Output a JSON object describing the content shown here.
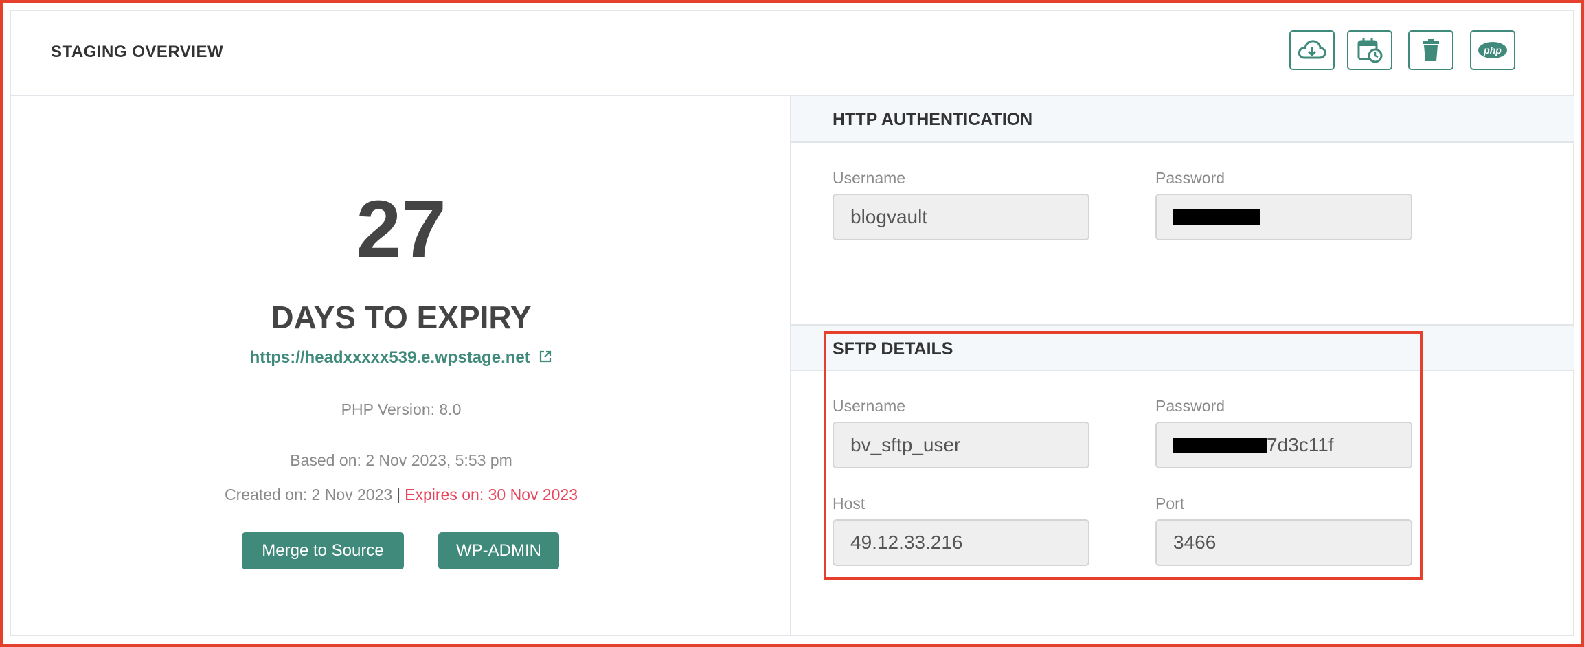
{
  "header": {
    "title": "STAGING OVERVIEW"
  },
  "toolbar": [
    {
      "name": "cloud-download-icon"
    },
    {
      "name": "calendar-clock-icon"
    },
    {
      "name": "trash-icon"
    },
    {
      "name": "php-icon",
      "label": "php"
    }
  ],
  "overview": {
    "days": "27",
    "days_label": "DAYS TO EXPIRY",
    "url": "https://headxxxxx539.e.wpstage.net",
    "php_version": "PHP Version: 8.0",
    "based_on": "Based on: 2 Nov 2023, 5:53 pm",
    "created_on": "Created on: 2 Nov 2023",
    "separator": "|",
    "expires_on": "Expires on: 30 Nov 2023",
    "merge_button": "Merge to Source",
    "wpadmin_button": "WP-ADMIN"
  },
  "http_auth": {
    "title": "HTTP AUTHENTICATION",
    "username_label": "Username",
    "username_value": "blogvault",
    "password_label": "Password"
  },
  "sftp": {
    "title": "SFTP DETAILS",
    "username_label": "Username",
    "username_value": "bv_sftp_user",
    "password_label": "Password",
    "password_suffix": "7d3c11f",
    "host_label": "Host",
    "host_value": "49.12.33.216",
    "port_label": "Port",
    "port_value": "3466"
  },
  "colors": {
    "accent": "#3f8a7b",
    "expiry_red": "#e6475c",
    "highlight": "#e5402b"
  }
}
